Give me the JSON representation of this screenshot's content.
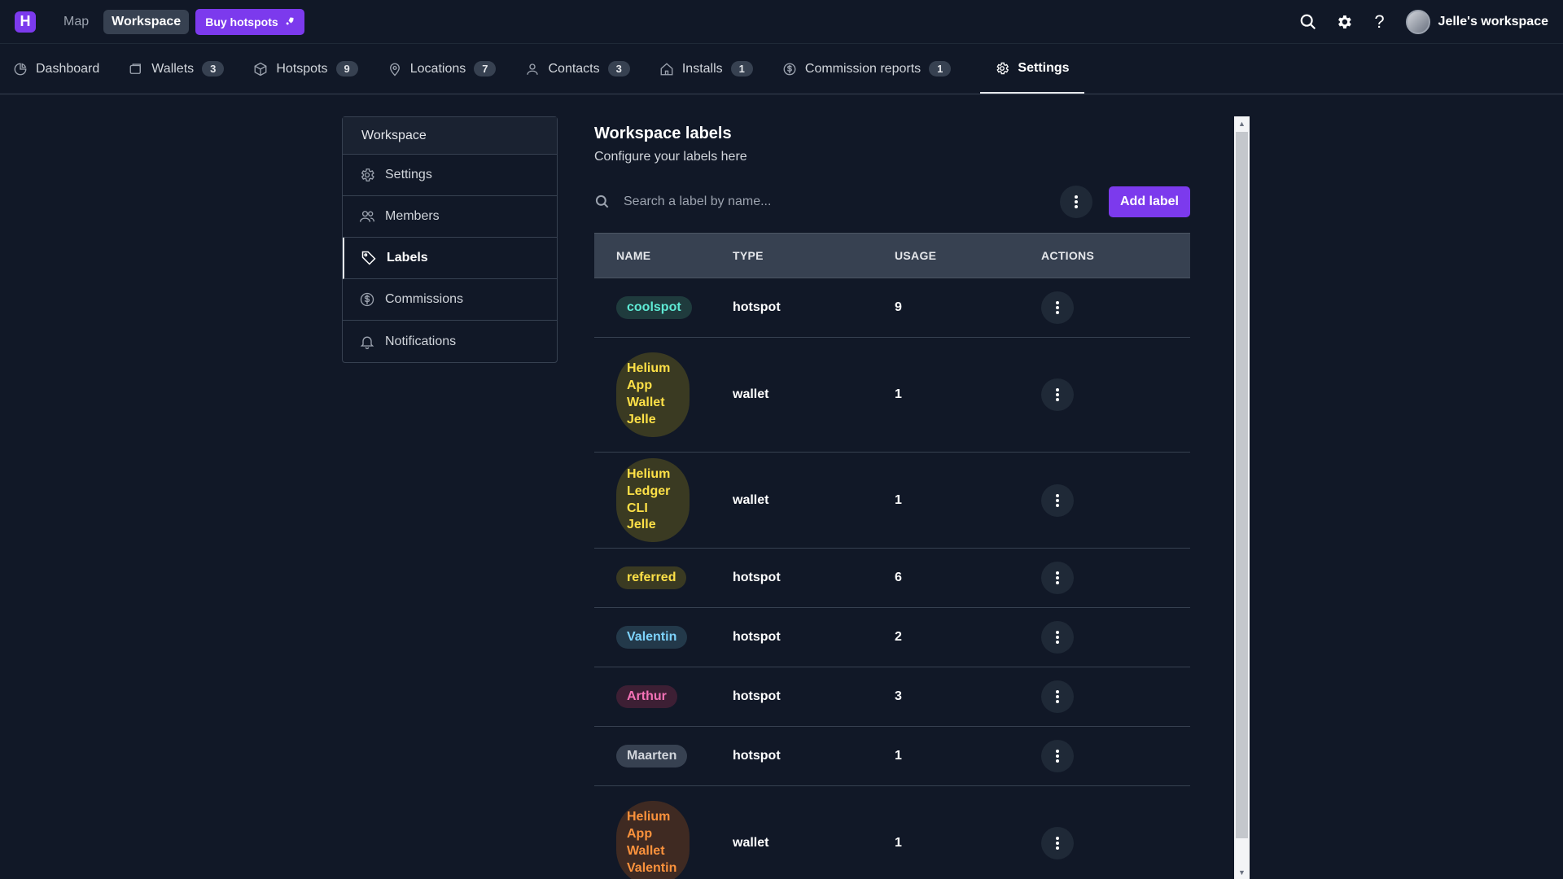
{
  "topbar": {
    "logo_letter": "H",
    "nav": [
      {
        "label": "Map",
        "active": false
      },
      {
        "label": "Workspace",
        "active": true
      }
    ],
    "buy_label": "Buy hotspots",
    "buy_icon": "rocket-icon",
    "workspace_name": "Jelle's workspace"
  },
  "tabs": [
    {
      "label": "Dashboard",
      "icon": "pie-chart-icon",
      "badge": ""
    },
    {
      "label": "Wallets",
      "icon": "wallet-icon",
      "badge": "3"
    },
    {
      "label": "Hotspots",
      "icon": "cube-icon",
      "badge": "9"
    },
    {
      "label": "Locations",
      "icon": "map-pin-icon",
      "badge": "7"
    },
    {
      "label": "Contacts",
      "icon": "user-icon",
      "badge": "3"
    },
    {
      "label": "Installs",
      "icon": "home-icon",
      "badge": "1"
    },
    {
      "label": "Commission reports",
      "icon": "dollar-circle-icon",
      "badge": "1"
    },
    {
      "label": "Settings",
      "icon": "gear-icon",
      "badge": "",
      "active": true
    }
  ],
  "sidemenu": {
    "header": "Workspace",
    "items": [
      {
        "label": "Settings",
        "icon": "gear-icon"
      },
      {
        "label": "Members",
        "icon": "users-icon"
      },
      {
        "label": "Labels",
        "icon": "tag-icon",
        "active": true
      },
      {
        "label": "Commissions",
        "icon": "dollar-circle-icon"
      },
      {
        "label": "Notifications",
        "icon": "bell-icon"
      }
    ]
  },
  "main": {
    "title": "Workspace labels",
    "subtitle": "Configure your labels here",
    "search_placeholder": "Search a label by name...",
    "add_label": "Add label"
  },
  "table": {
    "columns": [
      "NAME",
      "TYPE",
      "USAGE",
      "ACTIONS"
    ],
    "rows": [
      {
        "name": "coolspot",
        "type": "hotspot",
        "usage": "9",
        "color": "#5eead4",
        "bg": "#1f3b3d"
      },
      {
        "name": "Helium App Wallet Jelle",
        "type": "wallet",
        "usage": "1",
        "color": "#fde047",
        "bg": "#3a3a22"
      },
      {
        "name": "Helium Ledger CLI Jelle",
        "type": "wallet",
        "usage": "1",
        "color": "#fde047",
        "bg": "#3a3a22"
      },
      {
        "name": "referred",
        "type": "hotspot",
        "usage": "6",
        "color": "#fde047",
        "bg": "#3a3a22"
      },
      {
        "name": "Valentin",
        "type": "hotspot",
        "usage": "2",
        "color": "#7dd3fc",
        "bg": "#23394a"
      },
      {
        "name": "Arthur",
        "type": "hotspot",
        "usage": "3",
        "color": "#f472b6",
        "bg": "#3d1f34"
      },
      {
        "name": "Maarten",
        "type": "hotspot",
        "usage": "1",
        "color": "#d1d5db",
        "bg": "#374151"
      },
      {
        "name": "Helium App Wallet Valentin",
        "type": "wallet",
        "usage": "1",
        "color": "#fb923c",
        "bg": "#3f2a22"
      }
    ]
  }
}
